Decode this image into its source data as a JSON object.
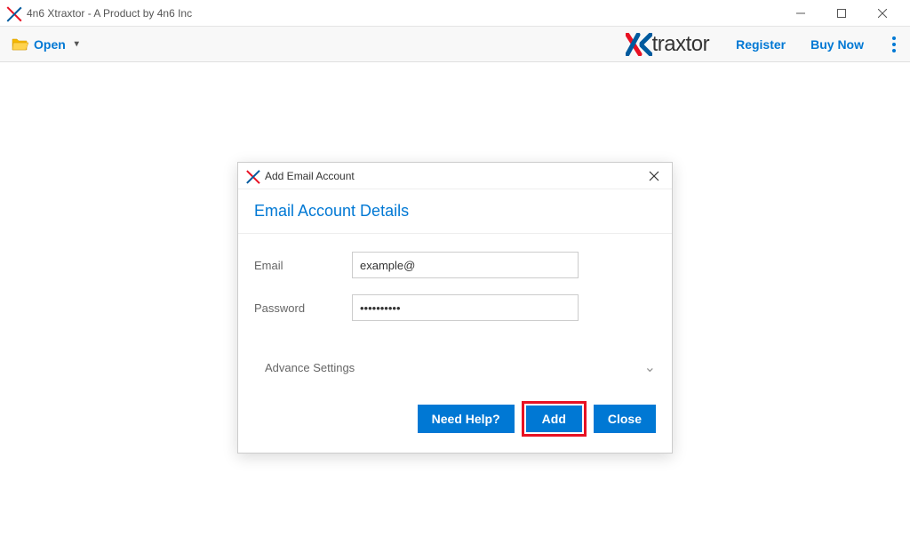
{
  "titlebar": {
    "title": "4n6 Xtraxtor - A Product by 4n6 Inc"
  },
  "toolbar": {
    "open_label": "Open",
    "register_label": "Register",
    "buy_now_label": "Buy Now",
    "brand_name": "traxtor"
  },
  "dialog": {
    "window_title": "Add Email Account",
    "header": "Email Account Details",
    "email_label": "Email",
    "email_value": "example@",
    "password_label": "Password",
    "password_value": "••••••••••",
    "advance_label": "Advance Settings",
    "need_help_label": "Need Help?",
    "add_label": "Add",
    "close_label": "Close"
  }
}
